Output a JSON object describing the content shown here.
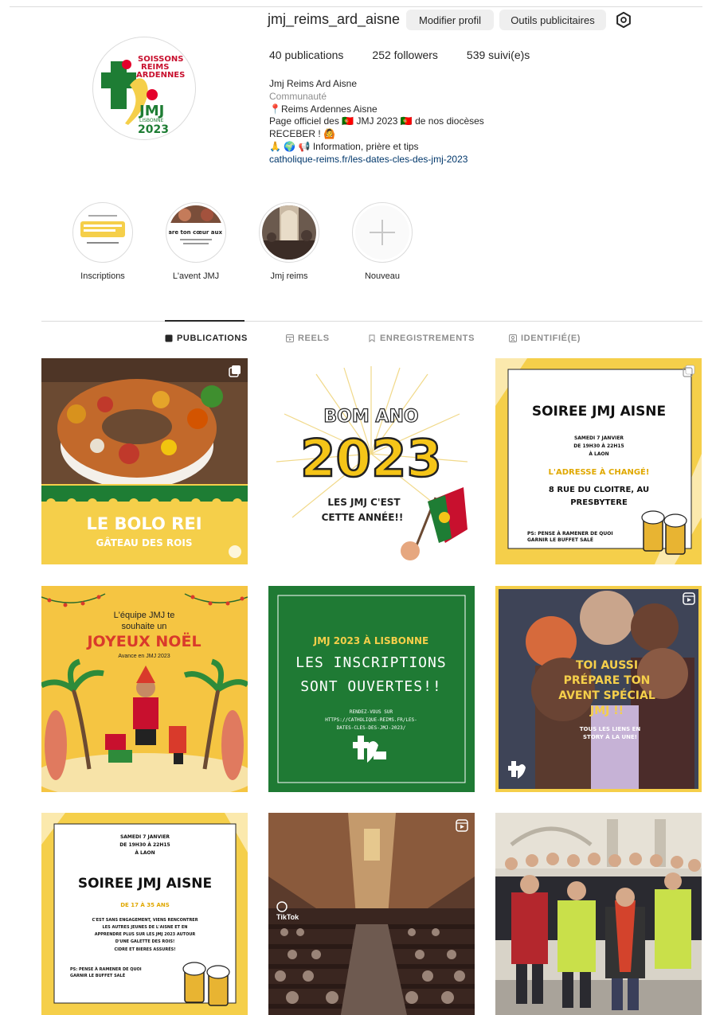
{
  "profile": {
    "username": "jmj_reims_ard_aisne",
    "edit_button": "Modifier profil",
    "ads_button": "Outils publicitaires",
    "stats": {
      "posts": "40 publications",
      "followers": "252 followers",
      "following": "539 suivi(e)s"
    },
    "bio": {
      "name": "Jmj Reims Ard Aisne",
      "category": "Communauté",
      "line1": "📍Reims Ardennes Aisne",
      "line2": "Page officiel des 🇵🇹 JMJ 2023 🇵🇹 de nos diocèses",
      "line3": "RECEBER ! 🙆",
      "line4": "🙏 🌍 📢 Information, prière et tips",
      "link": "catholique-reims.fr/les-dates-cles-des-jmj-2023"
    },
    "avatar_text": {
      "line1": "SOISSONS",
      "line2": "REIMS",
      "line3": "ARDENNES",
      "line4": "JMJ",
      "line5": "LISBONNE",
      "line6": "2023"
    }
  },
  "highlights": [
    {
      "label": "Inscriptions"
    },
    {
      "label": "L'avent JMJ"
    },
    {
      "label": "Jmj reims"
    },
    {
      "label": "Nouveau"
    }
  ],
  "highlight_art": {
    "h2_title": "Prépare ton cœur aux JMJ !"
  },
  "tabs": {
    "publications": "PUBLICATIONS",
    "reels": "REELS",
    "saved": "ENREGISTREMENTS",
    "tagged": "IDENTIFIÉ(E)"
  },
  "posts": {
    "p1": {
      "title": "LE BOLO REI",
      "subtitle": "GÂTEAU DES ROIS"
    },
    "p2": {
      "title1": "BOM ANO",
      "title2": "2023",
      "line1": "LES JMJ C'EST",
      "line2": "CETTE ANNÉE!!"
    },
    "p3": {
      "title": "SOIREE JMJ AISNE",
      "date": "SAMEDI 7 JANVIER",
      "time": "DE 19H30 À 22H15",
      "place": "À LAON",
      "changed": "L'ADRESSE À CHANGÉ!",
      "addr1": "8 RUE DU CLOITRE, AU",
      "addr2": "PRESBYTERE",
      "footer1": "PS: PENSE À RAMENER DE QUOI",
      "footer2": "GARNIR LE BUFFET SALÉ"
    },
    "p4": {
      "line1": "L'équipe JMJ te",
      "line2": "souhaite un",
      "title": "JOYEUX NOËL",
      "sub": "Avance en JMJ 2023"
    },
    "p5": {
      "head": "JMJ 2023 À LISBONNE",
      "line1": "LES INSCRIPTIONS",
      "line2": "SONT OUVERTES!!",
      "small1": "RENDEZ-VOUS SUR",
      "small2": "HTTPS://CATHOLIQUE-REIMS.FR/LES-",
      "small3": "DATES-CLES-DES-JMJ-2023/"
    },
    "p6": {
      "line1": "TOI AUSSI",
      "line2": "PRÉPARE TON",
      "line3": "AVENT SPÉCIAL",
      "line4": "JMJ !!",
      "small1": "TOUS LES LIENS EN",
      "small2": "STORY À LA UNE!"
    },
    "p7": {
      "date": "SAMEDI 7 JANVIER",
      "time": "DE 19H30 À 22H15",
      "place": "À LAON",
      "title": "SOIREE JMJ AISNE",
      "age": "DE 17 À 35 ANS",
      "b1": "C'EST SANS ENGAGEMENT, VIENS RENCONTRER",
      "b2": "LES AUTRES JEUNES DE L'AISNE ET EN",
      "b3": "APPRENDRE PLUS SUR LES JMJ 2023 AUTOUR",
      "b4": "D'UNE GALETTE DES ROIS!",
      "b5": "CIDRE ET BIERES ASSURÉS!",
      "footer1": "PS: PENSE À RAMENER DE QUOI",
      "footer2": "GARNIR LE BUFFET SALÉ"
    },
    "p8": {
      "watermark": "TikTok"
    }
  },
  "colors": {
    "jmj_green": "#1e7d34",
    "jmj_red": "#c8102e",
    "jmj_yellow": "#f5cf4a",
    "link": "#00376b",
    "muted": "#8e8e8e"
  }
}
